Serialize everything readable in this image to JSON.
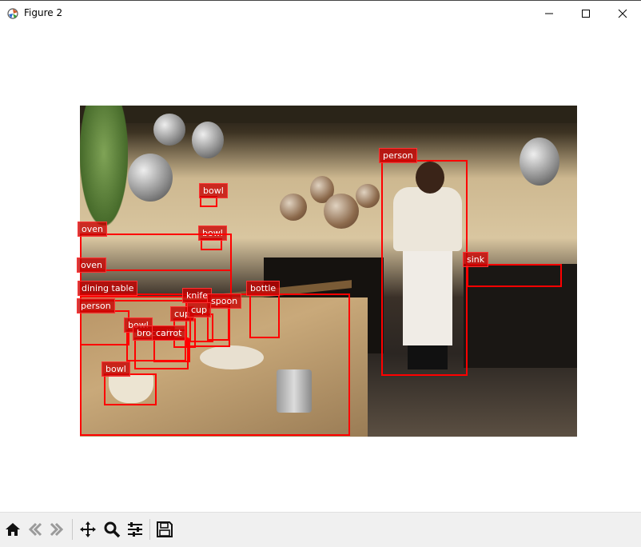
{
  "window": {
    "title": "Figure 2"
  },
  "window_controls": [
    "minimize-icon",
    "maximize-icon",
    "close-icon"
  ],
  "detections": [
    {
      "label": "person"
    },
    {
      "label": "bowl"
    },
    {
      "label": "bowl"
    },
    {
      "label": "oven"
    },
    {
      "label": "oven"
    },
    {
      "label": "sink"
    },
    {
      "label": "dining table"
    },
    {
      "label": "bottle"
    },
    {
      "label": "knife"
    },
    {
      "label": "spoon"
    },
    {
      "label": "cup"
    },
    {
      "label": "cup"
    },
    {
      "label": "person"
    },
    {
      "label": "bowl"
    },
    {
      "label": "broccoli"
    },
    {
      "label": "carrot"
    },
    {
      "label": "bowl"
    }
  ],
  "colors": {
    "box": "#ff0000",
    "label_bg": "#c80000",
    "label_text": "#ffffff",
    "toolbar_bg": "#f0f0f0"
  },
  "toolbar": {
    "buttons": [
      "home-icon",
      "back-icon",
      "forward-icon",
      "pan-icon",
      "zoom-icon",
      "configure-subplots-icon",
      "save-icon"
    ]
  }
}
